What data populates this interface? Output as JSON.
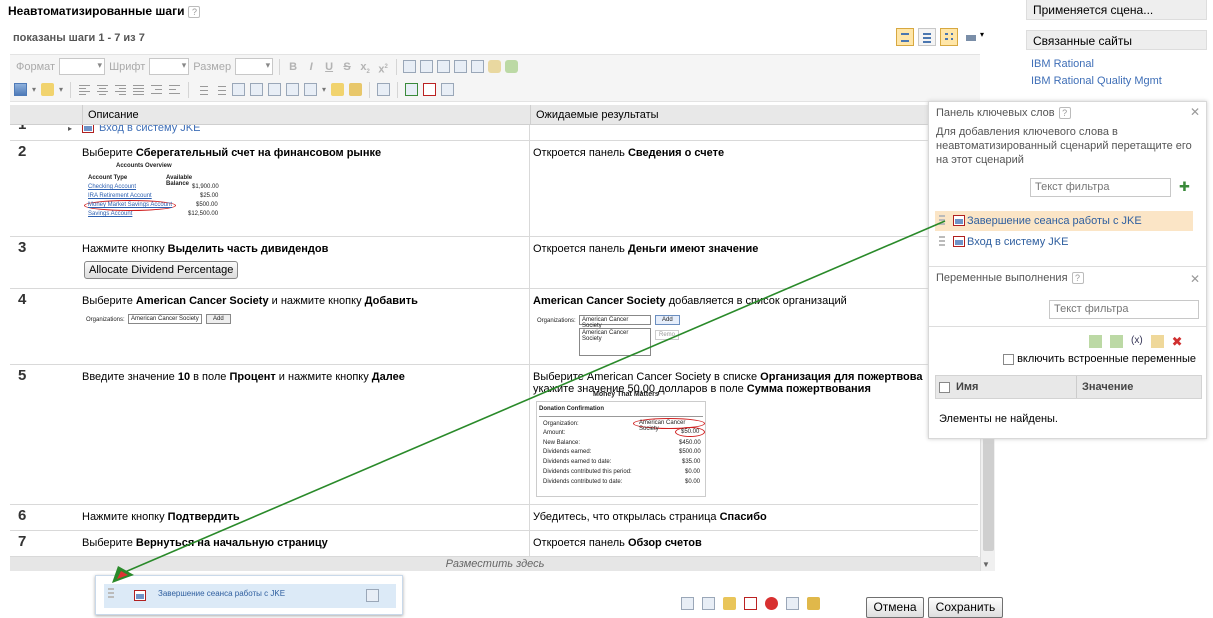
{
  "header": {
    "title": "Неавтоматизированные шаги",
    "help": "?",
    "steps_shown": "показаны шаги 1 - 7 из 7"
  },
  "toolbar": {
    "format_label": "Формат",
    "font_label": "Шрифт",
    "size_label": "Размер",
    "bold": "B",
    "italic": "I",
    "underline": "U",
    "strike": "S"
  },
  "table": {
    "col_description": "Описание",
    "col_expected": "Ожидаемые результаты",
    "row1": {
      "num": "1",
      "link": "Вход в систему JKE"
    },
    "row2": {
      "num": "2",
      "desc_pre": "Выберите ",
      "desc_bold": "Сберегательный счет на финансовом рынке",
      "exp_pre": "Откроется панель ",
      "exp_bold": "Сведения о счете",
      "img": {
        "title": "Accounts Overview",
        "col1": "Account Type",
        "col2": "Available Balance",
        "rows": [
          {
            "name": "Checking Account",
            "bal": "$1,900.00"
          },
          {
            "name": "IRA Retirement Account",
            "bal": "$25.00"
          },
          {
            "name": "Money Market Savings Account",
            "bal": "$500.00"
          },
          {
            "name": "Savings Account",
            "bal": "$12,500.00"
          }
        ]
      }
    },
    "row3": {
      "num": "3",
      "desc_pre": "Нажмите кнопку ",
      "desc_bold": "Выделить часть дивидендов",
      "button": "Allocate Dividend Percentage",
      "exp_pre": "Откроется панель ",
      "exp_bold": "Деньги имеют значение"
    },
    "row4": {
      "num": "4",
      "desc_pre": "Выберите ",
      "desc_bold1": "American Cancer Society",
      "desc_mid": " и нажмите кнопку ",
      "desc_bold2": "Добавить",
      "org_label": "Organizations:",
      "org_value": "American Cancer Society",
      "add": "Add",
      "remove": "Remo",
      "exp_bold": "American Cancer Society",
      "exp_post": " добавляется в список организаций"
    },
    "row5": {
      "num": "5",
      "desc_pre": "Введите значение ",
      "desc_bold1": "10",
      "desc_mid1": " в поле ",
      "desc_bold2": "Процент",
      "desc_mid2": " и нажмите кнопку ",
      "desc_bold3": "Далее",
      "exp_line1_pre": "Выберите American Cancer Society в списке ",
      "exp_line1_bold": "Организация для пожертвова",
      "exp_line2_pre": "укажите значение 50,00 долларов в поле ",
      "exp_line2_bold": "Сумма пожертвования",
      "img": {
        "title": "Money That Matters",
        "subtitle": "Donation Confirmation",
        "rows": [
          {
            "k": "Organization:",
            "v": "American Cancer Society"
          },
          {
            "k": "Amount:",
            "v": "$50.00"
          },
          {
            "k": "New Balance:",
            "v": "$450.00"
          },
          {
            "k": "Dividends earned:",
            "v": "$500.00"
          },
          {
            "k": "Dividends earned to date:",
            "v": "$35.00"
          },
          {
            "k": "Dividends contributed this period:",
            "v": "$0.00"
          },
          {
            "k": "Dividends contributed to date:",
            "v": "$0.00"
          }
        ]
      }
    },
    "row6": {
      "num": "6",
      "desc_pre": "Нажмите кнопку ",
      "desc_bold": "Подтвердить",
      "exp_pre": "Убедитесь, что открылась страница ",
      "exp_bold": "Спасибо"
    },
    "row7": {
      "num": "7",
      "desc_pre": "Выберите ",
      "desc_bold": "Вернуться на начальную страницу",
      "exp_pre": "Откроется панель ",
      "exp_bold": "Обзор счетов"
    },
    "drop_here": "Разместить здесь"
  },
  "drag_ghost": {
    "label": "Завершение сеанса работы с JKE"
  },
  "actions": {
    "cancel": "Отмена",
    "save": "Сохранить"
  },
  "right_panel": {
    "applied": "Применяется сцена...",
    "related_sites": "Связанные сайты",
    "links": [
      "IBM Rational",
      "IBM Rational Quality Mgmt"
    ]
  },
  "keywords_panel": {
    "title": "Панель ключевых слов",
    "hint": "Для добавления ключевого слова в неавтоматизированный сценарий перетащите его на этот сценарий",
    "filter_placeholder": "Текст фильтра",
    "items": [
      "Завершение сеанса работы с JKE",
      "Вход в систему JKE"
    ]
  },
  "variables_panel": {
    "title": "Переменные выполнения",
    "filter_placeholder": "Текст фильтра",
    "include_builtin": "включить встроенные переменные",
    "col_name": "Имя",
    "col_value": "Значение",
    "empty": "Элементы не найдены."
  },
  "colors": {
    "link": "#3f6fb7",
    "selected_row": "#fbe5c6",
    "drag_line": "#2a8a2a",
    "delete": "#d03030"
  }
}
